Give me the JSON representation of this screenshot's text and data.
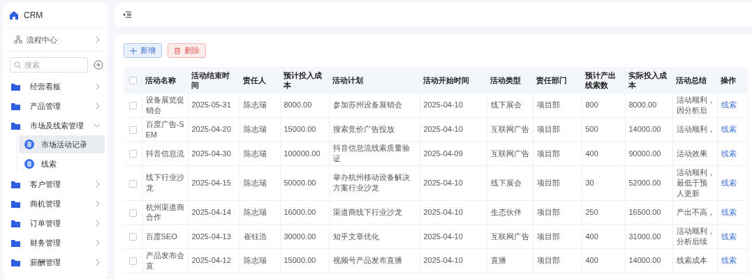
{
  "sidebar": {
    "brand": "CRM",
    "process_center": "流程中心",
    "search": {
      "placeholder": "搜索"
    },
    "items": [
      {
        "label": "经营看板",
        "expanded": false
      },
      {
        "label": "产品管理",
        "expanded": false
      },
      {
        "label": "市场及线索管理",
        "expanded": true,
        "children": [
          {
            "label": "市场活动记录",
            "selected": true
          },
          {
            "label": "线索",
            "selected": false
          }
        ]
      },
      {
        "label": "客户管理",
        "expanded": false
      },
      {
        "label": "商机管理",
        "expanded": false
      },
      {
        "label": "订单管理",
        "expanded": false
      },
      {
        "label": "财务管理",
        "expanded": false
      },
      {
        "label": "薪酬管理",
        "expanded": false
      }
    ]
  },
  "toolbar": {
    "add_button": "新增",
    "delete_button": "删除"
  },
  "table": {
    "all_checked": false,
    "columns": [
      "活动名称",
      "活动结束时间",
      "责任人",
      "预计投入成本",
      "活动计划",
      "活动开始时间",
      "活动类型",
      "责任部门",
      "预计产出线索数",
      "实际投入成本",
      "活动总结",
      "操作"
    ],
    "rows": [
      {
        "checked": false,
        "cells": [
          "设备展览促销会",
          "2025-05-31",
          "陈志瑞",
          "8000.00",
          "参加苏州设备展销会",
          "2025-04-10",
          "线下展会",
          "项目部",
          "800",
          "8000.00"
        ],
        "summary_lines": [
          "活动顺利，",
          "因分析后"
        ],
        "action": "线索"
      },
      {
        "checked": false,
        "cells": [
          "百度广告-SEM",
          "2025-04-20",
          "陈志瑞",
          "15000.00",
          "搜索竞价广告投放",
          "2025-04-10",
          "互联网广告",
          "项目部",
          "500",
          "14000.00"
        ],
        "summary_lines": [
          "活动顺利，"
        ],
        "action": "线索"
      },
      {
        "checked": false,
        "cells": [
          "抖音信息流",
          "2025-04-30",
          "陈志瑞",
          "100000.00",
          "抖音信息流线索质量验证",
          "2025-04-09",
          "互联网广告",
          "项目部",
          "400",
          "90000.00"
        ],
        "summary_lines": [
          "活动效果"
        ],
        "action": "线索"
      },
      {
        "checked": false,
        "cells": [
          "线下行业沙龙",
          "2025-04-15",
          "陈志瑞",
          "50000.00",
          "举办杭州移动设备解决方案行业沙龙",
          "2025-04-10",
          "线下展会",
          "项目部",
          "30",
          "52000.00"
        ],
        "summary_lines": [
          "活动顺利，",
          "最低于预",
          "人更新"
        ],
        "action": "线索"
      },
      {
        "checked": false,
        "cells": [
          "杭州渠道商合作",
          "2025-04-14",
          "陈志瑞",
          "16000.00",
          "渠道商线下行业沙龙",
          "2025-04-10",
          "生态伙伴",
          "项目部",
          "250",
          "16500.00"
        ],
        "summary_lines": [
          "产出不高，"
        ],
        "action": "线索"
      },
      {
        "checked": false,
        "cells": [
          "百度SEO",
          "2025-04-13",
          "崔钰浩",
          "30000.00",
          "知乎文章优化",
          "2025-04-10",
          "互联网广告",
          "项目部",
          "400",
          "31000.00"
        ],
        "summary_lines": [
          "活动顺利，",
          "分析后续"
        ],
        "action": "线索"
      },
      {
        "checked": false,
        "cells": [
          "产品发布会直",
          "2025-04-12",
          "陈志瑞",
          "15000.00",
          "视频号产品发布直播",
          "2025-04-10",
          "直播",
          "项目部",
          "400",
          "14000.00"
        ],
        "summary_lines": [
          "线索成本"
        ],
        "action": "线索"
      }
    ]
  }
}
